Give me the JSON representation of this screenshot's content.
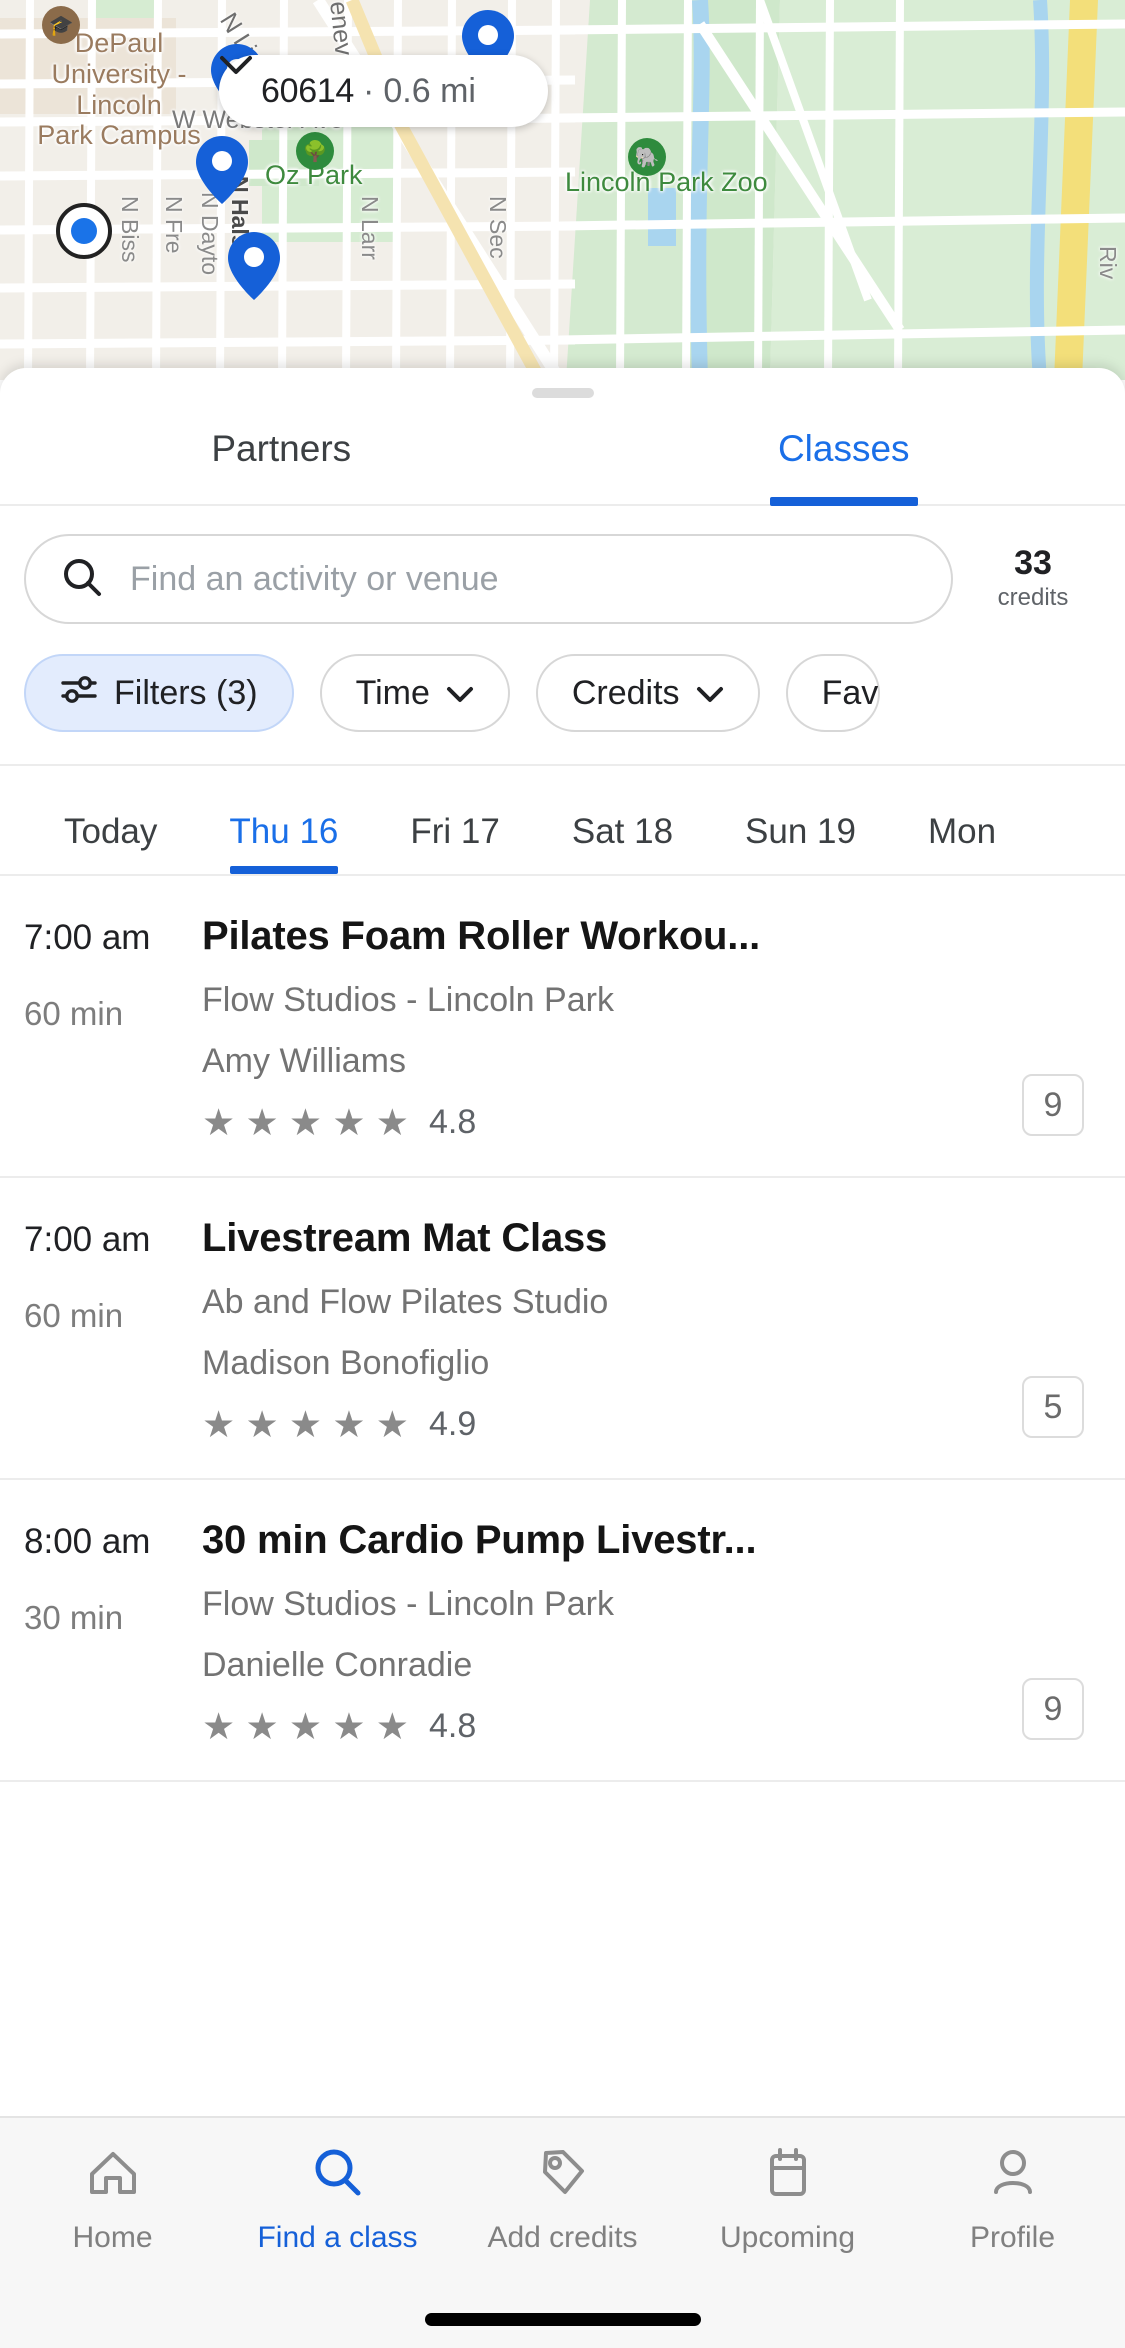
{
  "map": {
    "location_chip": {
      "zip": "60614",
      "separator": "·",
      "distance": "0.6 mi",
      "chevron_icon": "chevron-down-icon"
    },
    "labels": {
      "depaul": "DePaul\nUniversity -\nLincoln\nPark Campus",
      "webster": "W Webster Ave",
      "oz_park": "Oz Park",
      "lincoln_park_zoo": "Lincoln Park Zoo",
      "n_lincoln": "N Linc",
      "n_geneva": "eneva"
    },
    "streets_vertical": [
      "N Biss",
      "N Fre",
      "N Dayto",
      "N Hals",
      "N Larr",
      "N Sec",
      "Riv"
    ]
  },
  "sheet": {
    "tabs": [
      {
        "label": "Partners",
        "active": false
      },
      {
        "label": "Classes",
        "active": true
      }
    ],
    "search": {
      "placeholder": "Find an activity or venue",
      "icon": "search-icon",
      "value": ""
    },
    "credits": {
      "count": "33",
      "label": "credits"
    },
    "filters": [
      {
        "label": "Filters (3)",
        "icon": "sliders-icon",
        "primary": true,
        "chevron": false
      },
      {
        "label": "Time",
        "chevron": true,
        "primary": false
      },
      {
        "label": "Credits",
        "chevron": true,
        "primary": false
      },
      {
        "label": "Fav",
        "chevron": false,
        "primary": false
      }
    ],
    "dates": [
      {
        "label": "Today",
        "active": false
      },
      {
        "label": "Thu 16",
        "active": true
      },
      {
        "label": "Fri 17",
        "active": false
      },
      {
        "label": "Sat 18",
        "active": false
      },
      {
        "label": "Sun 19",
        "active": false
      },
      {
        "label": "Mon",
        "active": false
      }
    ],
    "classes": [
      {
        "time": "7:00 am",
        "duration": "60 min",
        "title": "Pilates Foam Roller Workou...",
        "venue": "Flow Studios - Lincoln Park",
        "instructor": "Amy Williams",
        "stars": "★ ★ ★ ★ ★",
        "rating": "4.8",
        "credits": "9"
      },
      {
        "time": "7:00 am",
        "duration": "60 min",
        "title": "Livestream Mat Class",
        "venue": "Ab and Flow Pilates Studio",
        "instructor": "Madison Bonofiglio",
        "stars": "★ ★ ★ ★ ★",
        "rating": "4.9",
        "credits": "5"
      },
      {
        "time": "8:00 am",
        "duration": "30 min",
        "title": "30 min Cardio Pump Livestr...",
        "venue": "Flow Studios - Lincoln Park",
        "instructor": "Danielle Conradie",
        "stars": "★ ★ ★ ★ ★",
        "rating": "4.8",
        "credits": "9"
      }
    ]
  },
  "bottom_nav": [
    {
      "label": "Home",
      "icon": "home-icon",
      "active": false
    },
    {
      "label": "Find a class",
      "icon": "search-icon",
      "active": true
    },
    {
      "label": "Add credits",
      "icon": "tag-icon",
      "active": false
    },
    {
      "label": "Upcoming",
      "icon": "calendar-icon",
      "active": false
    },
    {
      "label": "Profile",
      "icon": "person-icon",
      "active": false
    }
  ],
  "colors": {
    "accent": "#1560d8",
    "accent_text": "#1a6fe8",
    "muted": "#737373",
    "chip_fill": "#e3ecfd"
  }
}
